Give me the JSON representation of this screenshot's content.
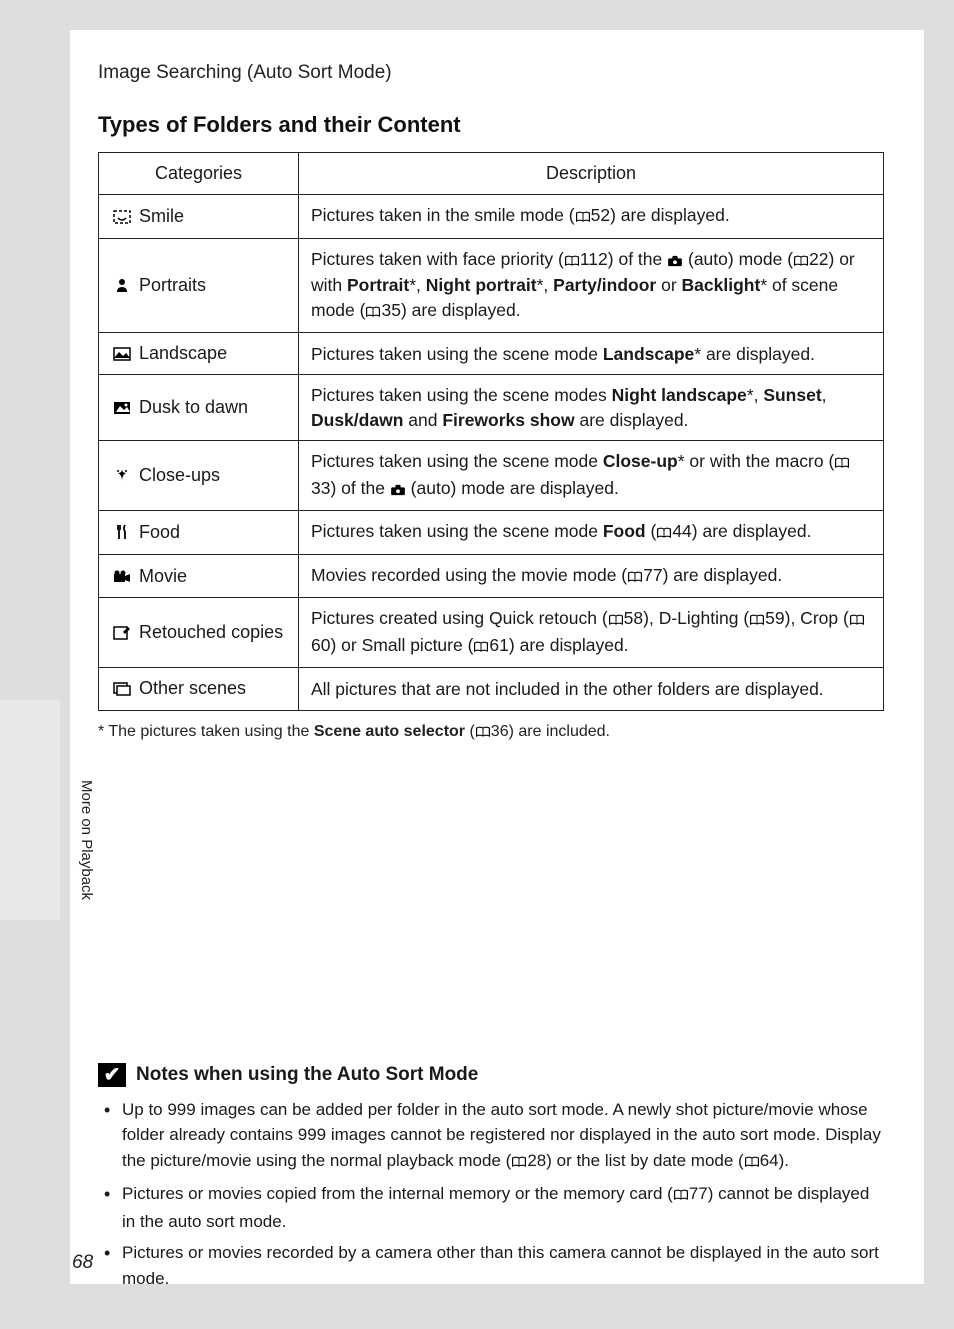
{
  "breadcrumb": "Image Searching (Auto Sort Mode)",
  "section_title": "Types of Folders and their Content",
  "table": {
    "headers": {
      "categories": "Categories",
      "description": "Description"
    },
    "rows": {
      "smile": {
        "label": "Smile",
        "ref1": "52"
      },
      "portraits": {
        "label": "Portraits",
        "ref1": "112",
        "ref2": "22",
        "ref3": "35"
      },
      "landscape": {
        "label": "Landscape"
      },
      "dusk": {
        "label": "Dusk to dawn"
      },
      "closeups": {
        "label": "Close-ups",
        "ref1": "33"
      },
      "food": {
        "label": "Food",
        "ref1": "44"
      },
      "movie": {
        "label": "Movie",
        "ref1": "77"
      },
      "retouched": {
        "label": "Retouched copies",
        "ref1": "58",
        "ref2": "59",
        "ref3": "60",
        "ref4": "61"
      },
      "other": {
        "label": "Other scenes"
      }
    }
  },
  "desc_text": {
    "smile_a": "Pictures taken in the smile mode (",
    "smile_b": ") are displayed.",
    "portraits_a": "Pictures taken with face priority (",
    "portraits_b": ") of the ",
    "portraits_c": " (auto) mode (",
    "portraits_d": ") or with ",
    "portraits_e": "Portrait",
    "portraits_f": "*, ",
    "portraits_g": "Night portrait",
    "portraits_h": "*, ",
    "portraits_i": "Party/indoor",
    "portraits_j": " or ",
    "portraits_k": "Backlight",
    "portraits_l": "* of scene mode (",
    "portraits_m": ") are displayed.",
    "landscape_a": "Pictures taken using the scene mode ",
    "landscape_b": "Landscape",
    "landscape_c": "* are displayed.",
    "dusk_a": "Pictures taken using the scene modes ",
    "dusk_b": "Night landscape",
    "dusk_c": "*, ",
    "dusk_d": "Sunset",
    "dusk_e": ", ",
    "dusk_f": "Dusk/dawn",
    "dusk_g": " and ",
    "dusk_h": "Fireworks show",
    "dusk_i": " are displayed.",
    "close_a": "Pictures taken using the scene mode ",
    "close_b": "Close-up",
    "close_c": "* or with the macro (",
    "close_d": ") of the ",
    "close_e": " (auto) mode are displayed.",
    "food_a": "Pictures taken using the scene mode ",
    "food_b": "Food",
    "food_c": " (",
    "food_d": ") are displayed.",
    "movie_a": "Movies recorded using the movie mode (",
    "movie_b": ") are displayed.",
    "ret_a": "Pictures created using Quick retouch (",
    "ret_b": "), D-Lighting (",
    "ret_c": "), Crop (",
    "ret_d": ") or Small picture (",
    "ret_e": ") are displayed.",
    "other_a": "All pictures that are not included in the other folders are displayed."
  },
  "footnote": {
    "a": "*   The pictures taken using the ",
    "b": "Scene auto selector",
    "c": " (",
    "ref": "36",
    "d": ") are included."
  },
  "notes": {
    "title": "Notes when using the Auto Sort Mode",
    "item1_a": "Up to 999 images can be added per folder in the auto sort mode. A newly shot picture/movie whose folder already contains 999 images cannot be registered nor displayed in the auto sort mode. Display the picture/movie using the normal playback mode (",
    "item1_ref1": "28",
    "item1_b": ") or the list by date mode (",
    "item1_ref2": "64",
    "item1_c": ").",
    "item2_a": "Pictures or movies copied from the internal memory or the memory card (",
    "item2_ref": "77",
    "item2_b": ") cannot be displayed in the auto sort mode.",
    "item3": "Pictures or movies recorded by a camera other than this camera cannot be displayed in the auto sort mode."
  },
  "side_label": "More on Playback",
  "page_number": "68"
}
